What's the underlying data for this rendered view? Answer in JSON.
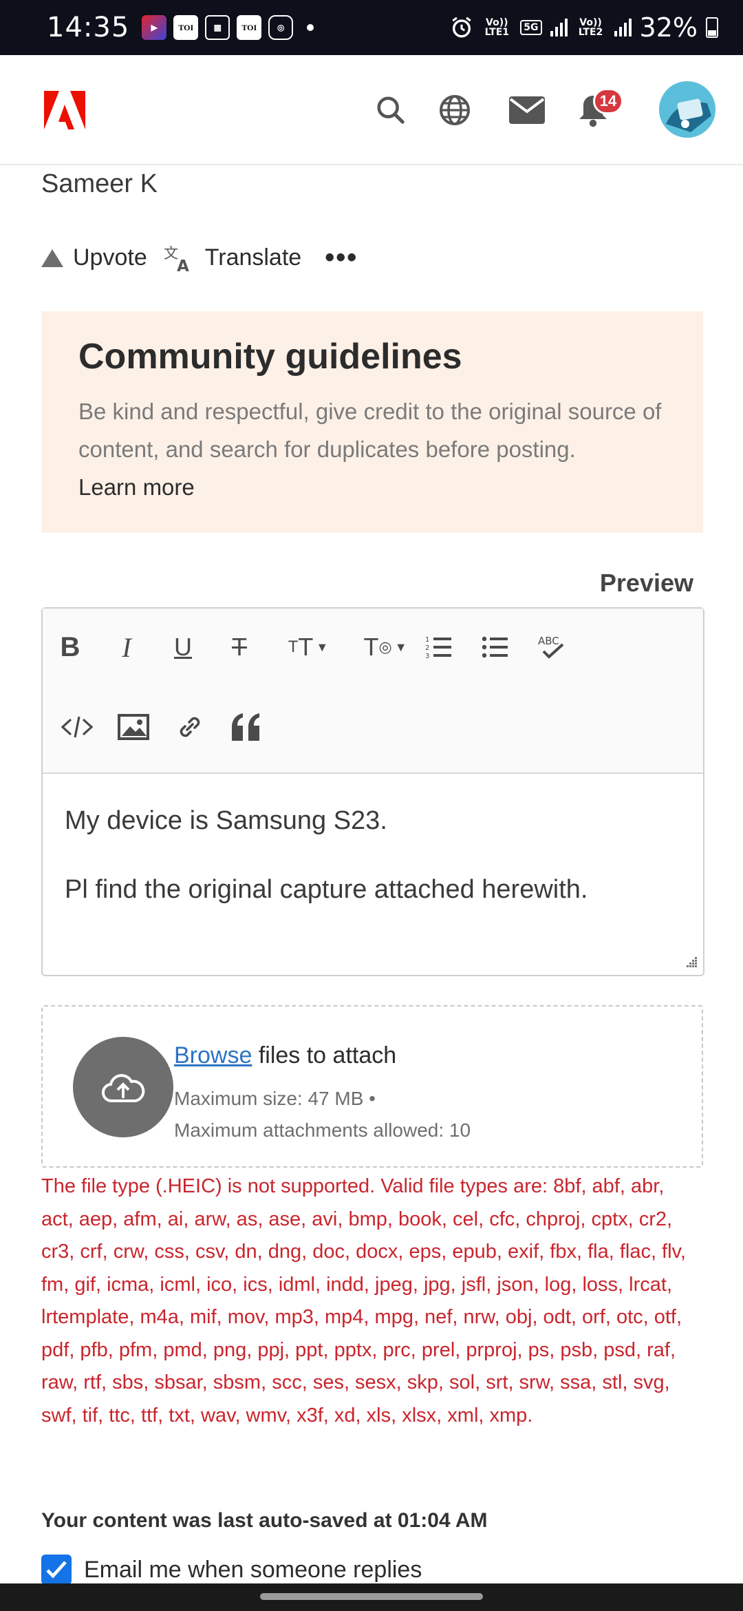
{
  "status_bar": {
    "time": "14:35",
    "apps": [
      "TOI",
      "TOI"
    ],
    "network1": "Vo)) LTE1",
    "network_5g": "5G",
    "network2": "Vo)) LTE2",
    "battery": "32%"
  },
  "header": {
    "logo": "adobe-logo",
    "notifications_count": "14"
  },
  "post": {
    "author": "Sameer K",
    "upvote_label": "Upvote",
    "translate_label": "Translate",
    "more_label": "•••"
  },
  "guidelines": {
    "title": "Community guidelines",
    "text": "Be kind and respectful, give credit to the original source of content, and search for duplicates before posting.",
    "learn_more": "Learn more"
  },
  "editor": {
    "preview_label": "Preview",
    "toolbar": [
      "bold",
      "italic",
      "underline",
      "strikethrough",
      "font-size",
      "text-style",
      "numbered-list",
      "bulleted-list",
      "spellcheck",
      "code",
      "image",
      "link",
      "quote"
    ],
    "line1": "My device is Samsung S23.",
    "line2": "Pl find the original capture attached herewith."
  },
  "upload": {
    "browse_label": "Browse",
    "attach_label": " files to attach",
    "max_size": "Maximum size: 47 MB •",
    "max_attachments": "Maximum attachments allowed: 10"
  },
  "error_message": "The file type (.HEIC) is not supported. Valid file types are: 8bf, abf, abr, act, aep, afm, ai, arw, as, ase, avi, bmp, book, cel, cfc, chproj, cptx, cr2, cr3, crf, crw, css, csv, dn, dng, doc, docx, eps, epub, exif, fbx, fla, flac, flv, fm, gif, icma, icml, ico, ics, idml, indd, jpeg, jpg, jsfl, json, log, loss, lrcat, lrtemplate, m4a, mif, mov, mp3, mp4, mpg, nef, nrw, obj, odt, orf, otc, otf, pdf, pfb, pfm, pmd, png, ppj, ppt, pptx, prc, prel, prproj, ps, psb, psd, raf, raw, rtf, sbs, sbsar, sbsm, scc, ses, sesx, skp, sol, srt, srw, ssa, stl, svg, swf, tif, ttc, ttf, txt, wav, wmv, x3f, xd, xls, xlsx, xml, xmp.",
  "footer": {
    "autosave_text": "Your content was last auto-saved at 01:04 AM",
    "email_label": "Email me when someone replies",
    "email_checked": true
  },
  "colors": {
    "accent": "#1473e6",
    "error": "#c9252d",
    "badge": "#d7373f",
    "guidelines_bg": "#fdf1e7",
    "adobe_red": "#eb1000"
  }
}
